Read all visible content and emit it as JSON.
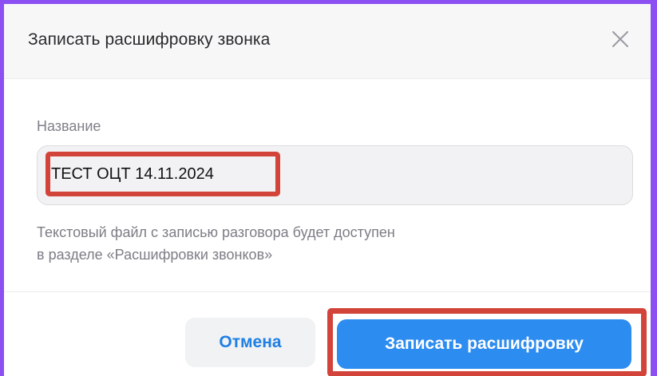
{
  "dialog": {
    "title": "Записать расшифровку звонка",
    "close_icon": "close-icon"
  },
  "form": {
    "name_label": "Название",
    "name_value": "ТЕСТ ОЦТ 14.11.2024",
    "hint_line1": "Текстовый файл с записью разговора будет доступен",
    "hint_line2": "в разделе «Расшифровки звонков»"
  },
  "footer": {
    "cancel_label": "Отмена",
    "submit_label": "Записать расшифровку"
  },
  "colors": {
    "frame_border": "#8b4ff2",
    "highlight": "#d2433a",
    "primary": "#2d8cf0",
    "cancel_text": "#1f7fe3"
  }
}
